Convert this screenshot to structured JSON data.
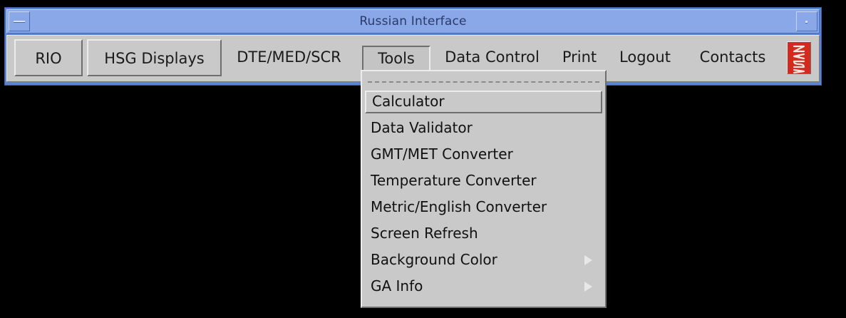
{
  "window": {
    "title": "Russian Interface"
  },
  "menubar": {
    "items": [
      {
        "label": "RIO"
      },
      {
        "label": "HSG Displays"
      },
      {
        "label": "DTE/MED/SCR"
      },
      {
        "label": "Tools"
      },
      {
        "label": "Data Control"
      },
      {
        "label": "Print"
      },
      {
        "label": "Logout"
      },
      {
        "label": "Contacts"
      }
    ],
    "logo": "NASA"
  },
  "tools_menu": {
    "items": [
      {
        "label": "Calculator",
        "highlighted": true
      },
      {
        "label": "Data Validator"
      },
      {
        "label": "GMT/MET Converter"
      },
      {
        "label": "Temperature Converter"
      },
      {
        "label": "Metric/English Converter"
      },
      {
        "label": "Screen Refresh"
      },
      {
        "label": "Background Color",
        "submenu": true
      },
      {
        "label": "GA Info",
        "submenu": true
      }
    ]
  },
  "colors": {
    "title_bar": "#8aa8e8",
    "window_border": "#5b82d3",
    "menu_bg": "#c9c9c9",
    "background": "#000000",
    "logo_red": "#d42a1e"
  }
}
